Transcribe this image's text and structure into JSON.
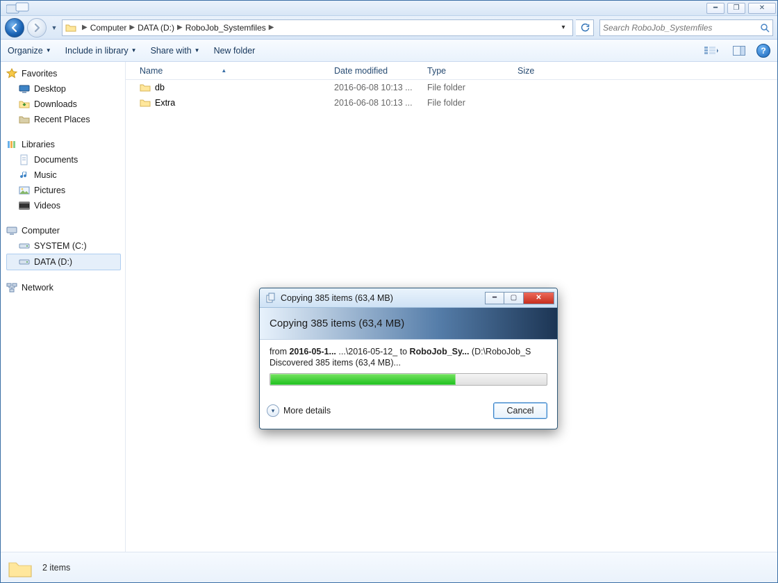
{
  "titlebar": {
    "min": "━",
    "max": "❐",
    "close": "✕"
  },
  "breadcrumb": {
    "root": "Computer",
    "a": "DATA (D:)",
    "b": "RoboJob_Systemfiles"
  },
  "search": {
    "placeholder": "Search RoboJob_Systemfiles"
  },
  "toolbar": {
    "organize": "Organize",
    "include": "Include in library",
    "share": "Share with",
    "newfolder": "New folder"
  },
  "nav": {
    "favorites": "Favorites",
    "desktop": "Desktop",
    "downloads": "Downloads",
    "recent": "Recent Places",
    "libraries": "Libraries",
    "documents": "Documents",
    "music": "Music",
    "pictures": "Pictures",
    "videos": "Videos",
    "computer": "Computer",
    "sysc": "SYSTEM (C:)",
    "datad": "DATA (D:)",
    "network": "Network"
  },
  "cols": {
    "name": "Name",
    "date": "Date modified",
    "type": "Type",
    "size": "Size"
  },
  "rows": [
    {
      "name": "db",
      "date": "2016-06-08 10:13 ...",
      "type": "File folder",
      "size": ""
    },
    {
      "name": "Extra",
      "date": "2016-06-08 10:13 ...",
      "type": "File folder",
      "size": ""
    }
  ],
  "status": {
    "count": "2 items"
  },
  "dialog": {
    "caption": "Copying 385 items (63,4 MB)",
    "heading": "Copying 385 items (63,4 MB)",
    "from_label": "from ",
    "from_bold": "2016-05-1...",
    "mid1": "  ...\\2016-05-12_ to ",
    "to_bold": "RoboJob_Sy...",
    "mid2": " (D:\\RoboJob_S",
    "discovered": "Discovered 385 items (63,4 MB)...",
    "more": "More details",
    "cancel": "Cancel",
    "progress_percent": 67
  }
}
